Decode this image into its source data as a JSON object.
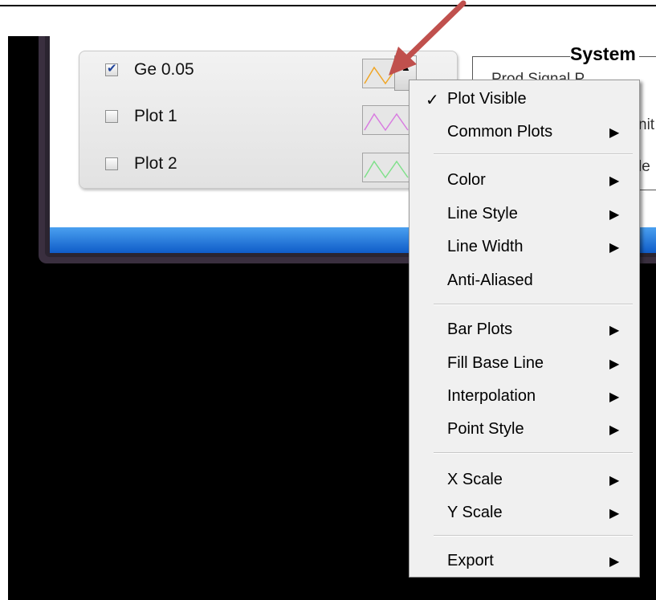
{
  "legend": {
    "rows": [
      {
        "label": "Ge 0.05",
        "checked": true,
        "color": "#f0a524"
      },
      {
        "label": "Plot 1",
        "checked": false,
        "color": "#d87be0"
      },
      {
        "label": "Plot 2",
        "checked": false,
        "color": "#7fe08a"
      }
    ],
    "scroll_up_icon": "triangle-up-icon"
  },
  "system_panel": {
    "title": "System",
    "partial_lines": [
      "Prod Signal P",
      "nit",
      "le"
    ]
  },
  "context_menu": {
    "items": [
      {
        "label": "Plot Visible",
        "checked": true,
        "submenu": false
      },
      {
        "label": "Common Plots",
        "checked": false,
        "submenu": true
      },
      {
        "label": "Color",
        "checked": false,
        "submenu": true
      },
      {
        "label": "Line Style",
        "checked": false,
        "submenu": true
      },
      {
        "label": "Line Width",
        "checked": false,
        "submenu": true
      },
      {
        "label": "Anti-Aliased",
        "checked": false,
        "submenu": false
      },
      {
        "label": "Bar Plots",
        "checked": false,
        "submenu": true
      },
      {
        "label": "Fill Base Line",
        "checked": false,
        "submenu": true
      },
      {
        "label": "Interpolation",
        "checked": false,
        "submenu": true
      },
      {
        "label": "Point Style",
        "checked": false,
        "submenu": true
      },
      {
        "label": "X Scale",
        "checked": false,
        "submenu": true
      },
      {
        "label": "Y Scale",
        "checked": false,
        "submenu": true
      },
      {
        "label": "Export",
        "checked": false,
        "submenu": true
      }
    ]
  },
  "colors": {
    "annotation_arrow": "#c0504d",
    "window_blue_bar": "#1a6fd8",
    "menu_background": "#f0f0f0"
  }
}
